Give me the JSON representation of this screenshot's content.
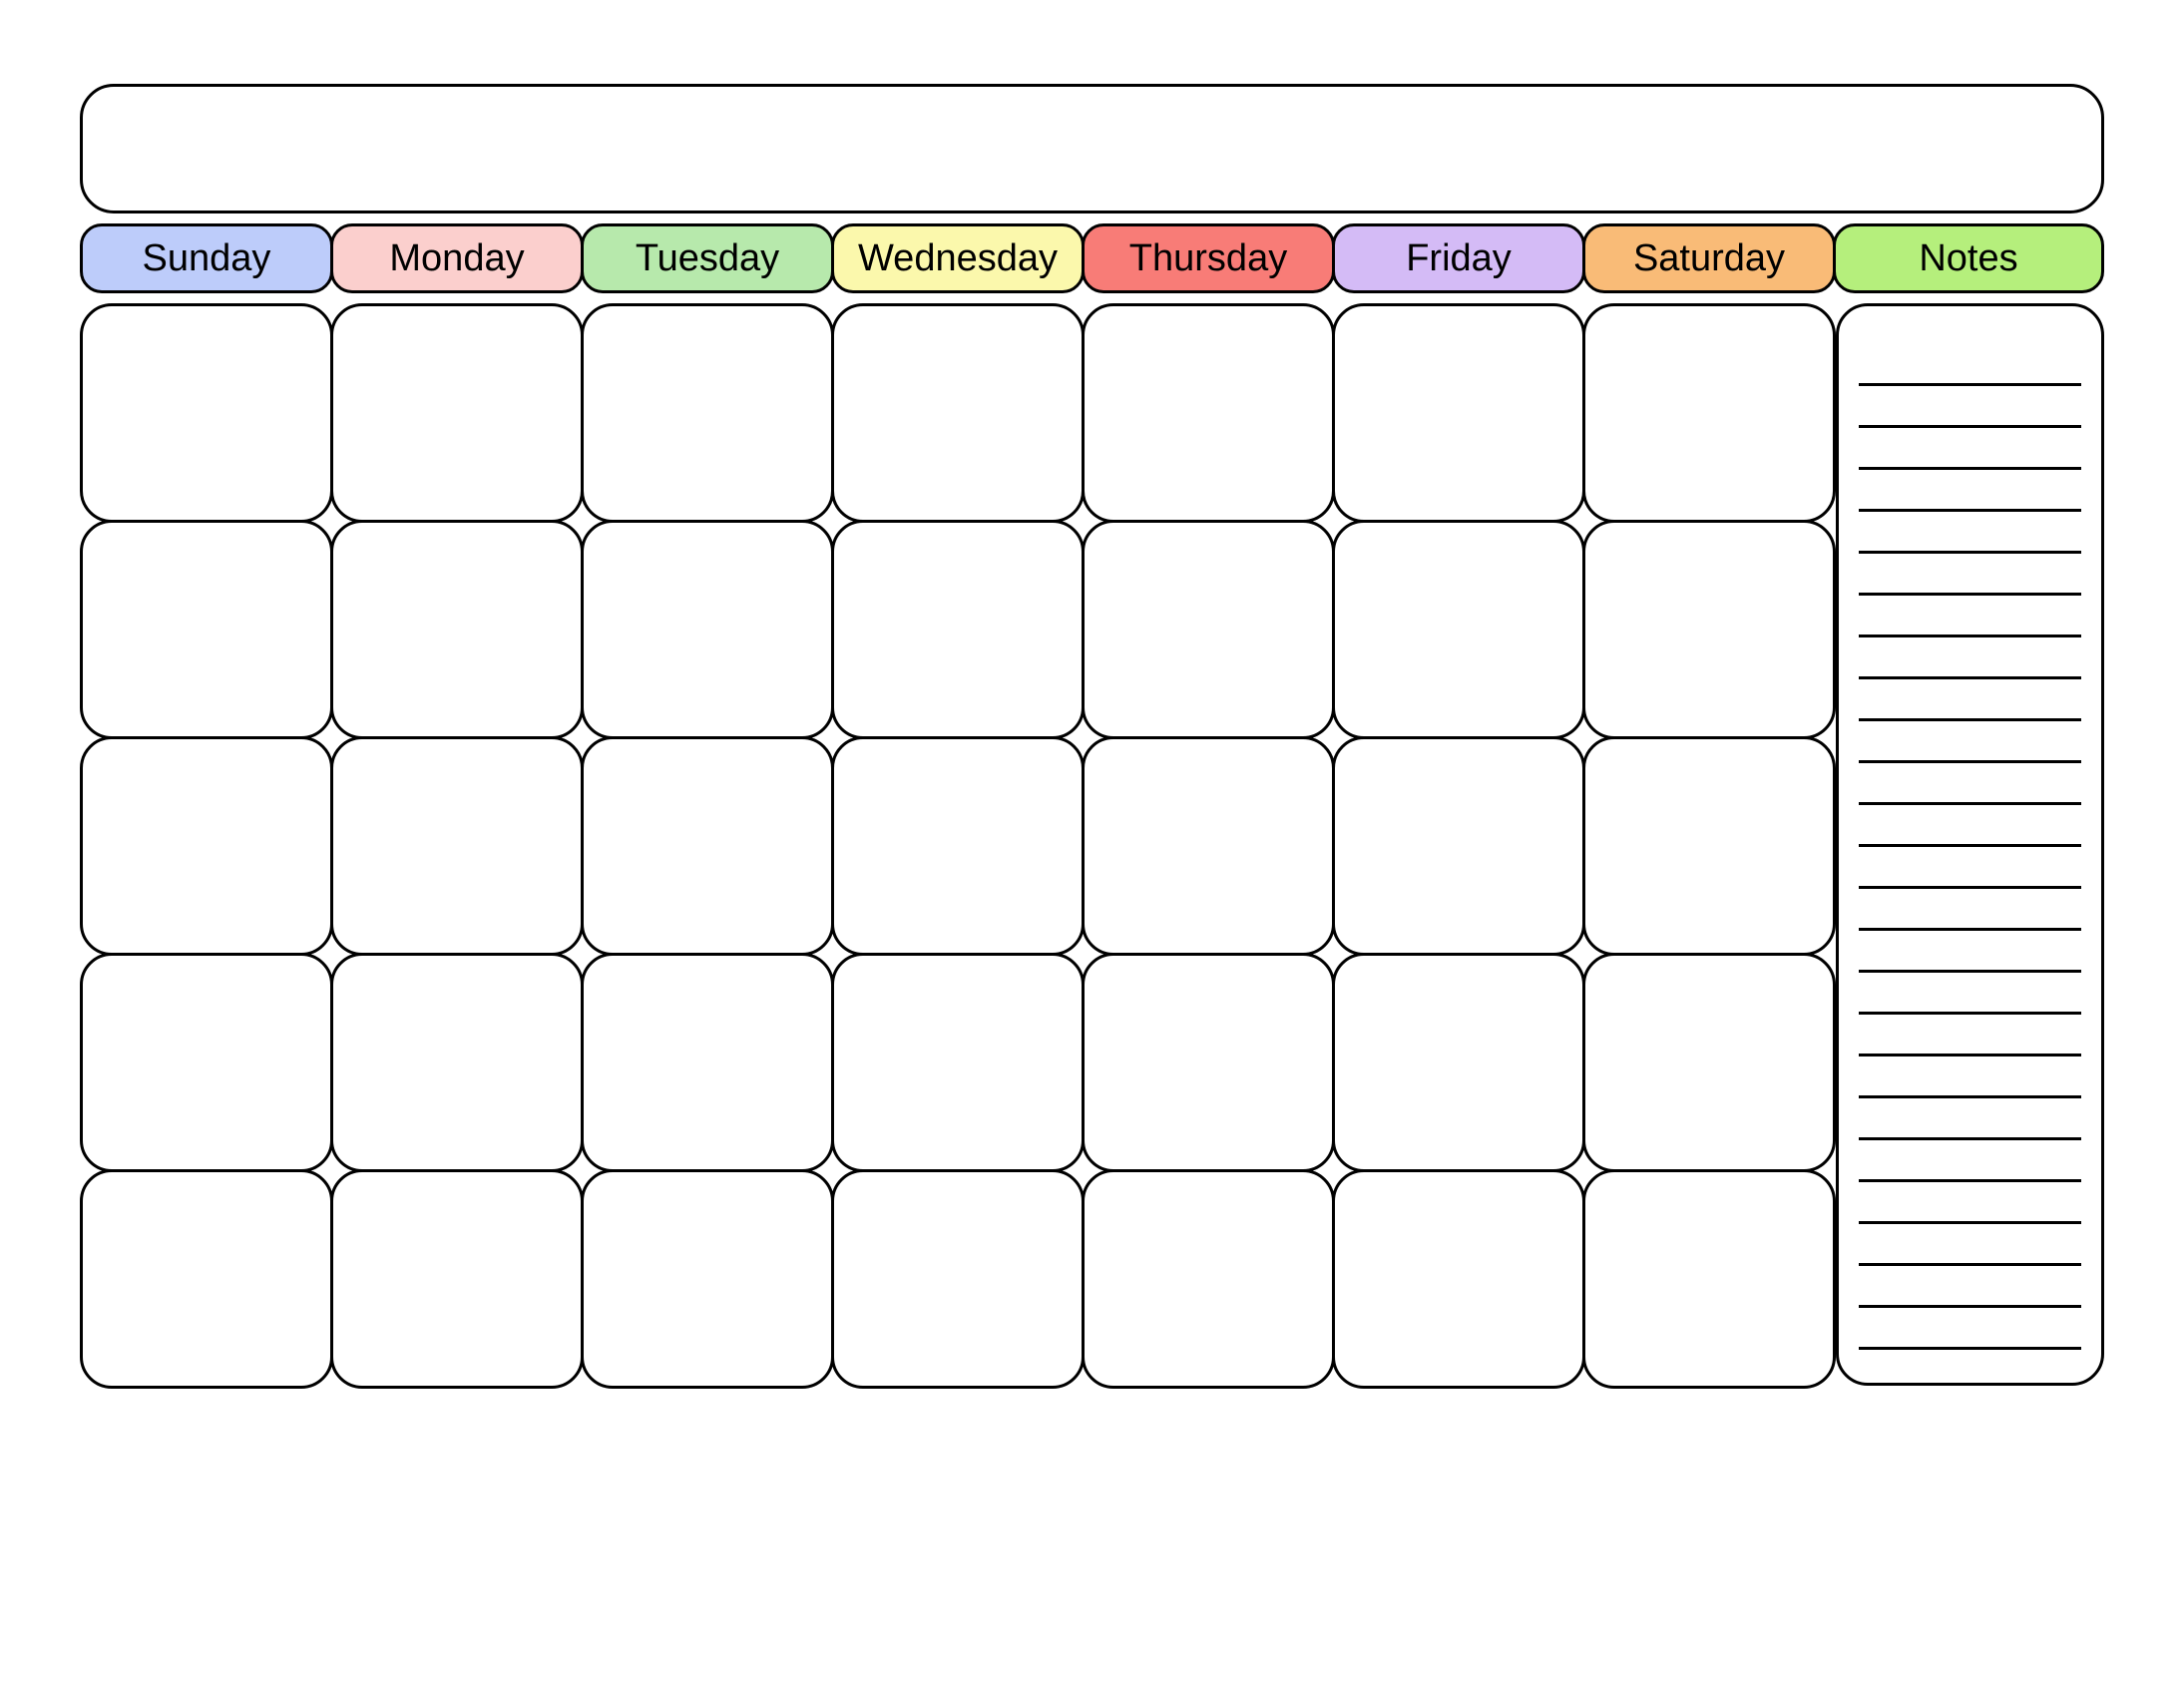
{
  "title": "",
  "days": {
    "sunday": "Sunday",
    "monday": "Monday",
    "tuesday": "Tuesday",
    "wednesday": "Wednesday",
    "thursday": "Thursday",
    "friday": "Friday",
    "saturday": "Saturday"
  },
  "notes_label": "Notes",
  "weeks": 5,
  "note_lines": 24,
  "colors": {
    "sunday": "#bdccfa",
    "monday": "#fbcfcd",
    "tuesday": "#b7e9ac",
    "wednesday": "#fbf8ac",
    "thursday": "#f87c77",
    "friday": "#d4bbf6",
    "saturday": "#f9bb77",
    "notes": "#b5ef7c"
  }
}
